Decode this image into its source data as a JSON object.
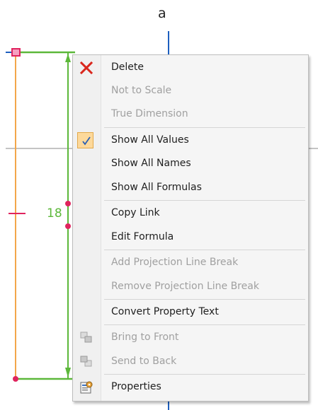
{
  "drawing": {
    "view_label": "a",
    "dimension_value": "18"
  },
  "context_menu": {
    "items": [
      {
        "label": "Delete",
        "icon": "delete-x-icon",
        "enabled": true
      },
      {
        "label": "Not to Scale",
        "enabled": false
      },
      {
        "label": "True Dimension",
        "enabled": false
      },
      {
        "label": "Show All Values",
        "icon": "checkmark-icon",
        "checked": true,
        "enabled": true
      },
      {
        "label": "Show All Names",
        "enabled": true
      },
      {
        "label": "Show All Formulas",
        "enabled": true
      },
      {
        "label": "Copy Link",
        "enabled": true
      },
      {
        "label": "Edit Formula",
        "enabled": true
      },
      {
        "label": "Add Projection Line Break",
        "enabled": false
      },
      {
        "label": "Remove Projection Line Break",
        "enabled": false
      },
      {
        "label": "Convert Property Text",
        "enabled": true
      },
      {
        "label": "Bring to Front",
        "icon": "bring-to-front-icon",
        "enabled": false
      },
      {
        "label": "Send to Back",
        "icon": "send-to-back-icon",
        "enabled": false
      },
      {
        "label": "Properties",
        "icon": "properties-icon",
        "enabled": true
      }
    ]
  },
  "colors": {
    "dimension_line": "#5cb83a",
    "model_edge": "#f3a64a",
    "grip_point": "#e0245e",
    "axis_blue": "#1d5fbf",
    "delete_red": "#d9261c"
  }
}
